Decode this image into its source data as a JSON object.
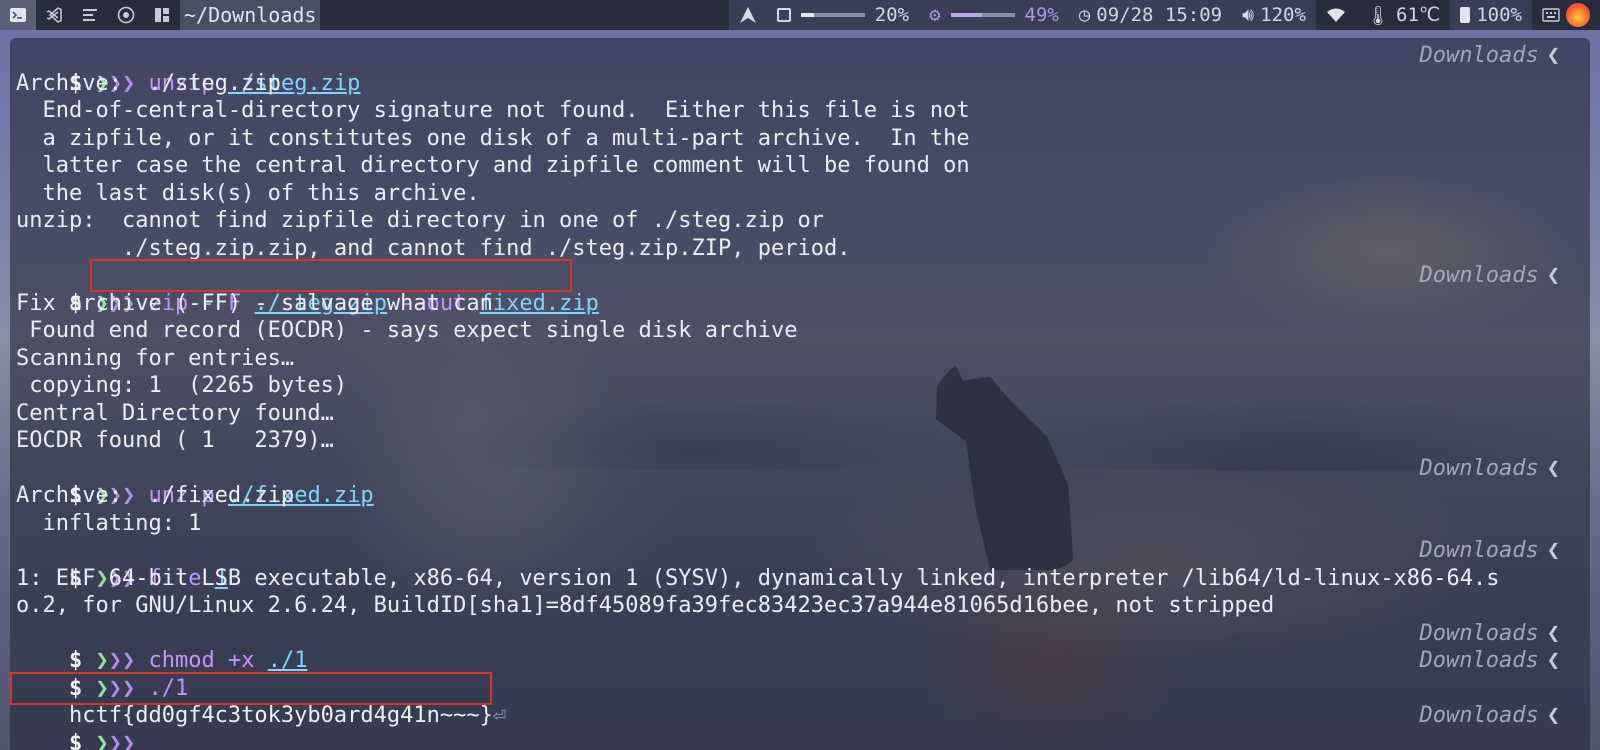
{
  "topbar": {
    "path": "~/Downloads",
    "cpu_label": "20%",
    "cpu_level": 0.2,
    "mem_label": "49%",
    "mem_level": 0.49,
    "clock": "09/28 15:09",
    "volume": "120%",
    "temp": "61℃",
    "battery": "100%"
  },
  "prompt": {
    "dollar": "$",
    "chevron_green": "❯",
    "chevrons_purple": "❯❯",
    "dir": "Downloads",
    "rprompt_arrow": "❮"
  },
  "terminal": {
    "cmd1": {
      "cmd": "unzip",
      "arg": "./steg.zip"
    },
    "out1": [
      "Archive:  ./steg.zip",
      "  End-of-central-directory signature not found.  Either this file is not",
      "  a zipfile, or it constitutes one disk of a multi-part archive.  In the",
      "  latter case the central directory and zipfile comment will be found on",
      "  the last disk(s) of this archive.",
      "unzip:  cannot find zipfile directory in one of ./steg.zip or",
      "        ./steg.zip.zip, and cannot find ./steg.zip.ZIP, period."
    ],
    "cmd2": {
      "cmd": "zip",
      "flag1": "-FF",
      "arg1": "./steg.zip",
      "flag2": "--out",
      "arg2": "fixed.zip"
    },
    "out2": [
      "Fix archive (-FF) - salvage what can",
      " Found end record (EOCDR) - says expect single disk archive",
      "Scanning for entries…",
      " copying: 1  (2265 bytes)",
      "Central Directory found…",
      "EOCDR found ( 1   2379)…"
    ],
    "cmd3": {
      "cmd": "unzip",
      "arg": "./fixed.zip"
    },
    "out3": [
      "Archive:  ./fixed.zip",
      "  inflating: 1"
    ],
    "cmd4": {
      "cmd": "file",
      "arg": "1"
    },
    "out4": [
      "1: ELF 64-bit LSB executable, x86-64, version 1 (SYSV), dynamically linked, interpreter /lib64/ld-linux-x86-64.s",
      "o.2, for GNU/Linux 2.6.24, BuildID[sha1]=8df45089fa39fec83423ec37a944e81065d16bee, not stripped"
    ],
    "cmd5": {
      "cmd": "chmod",
      "flag": "+x",
      "arg": "./1"
    },
    "cmd6": {
      "cmd": "./1"
    },
    "flag_output": "hctf{dd0gf4c3tok3yb0ard4g41n~~~}",
    "return_glyph": "⏎"
  }
}
